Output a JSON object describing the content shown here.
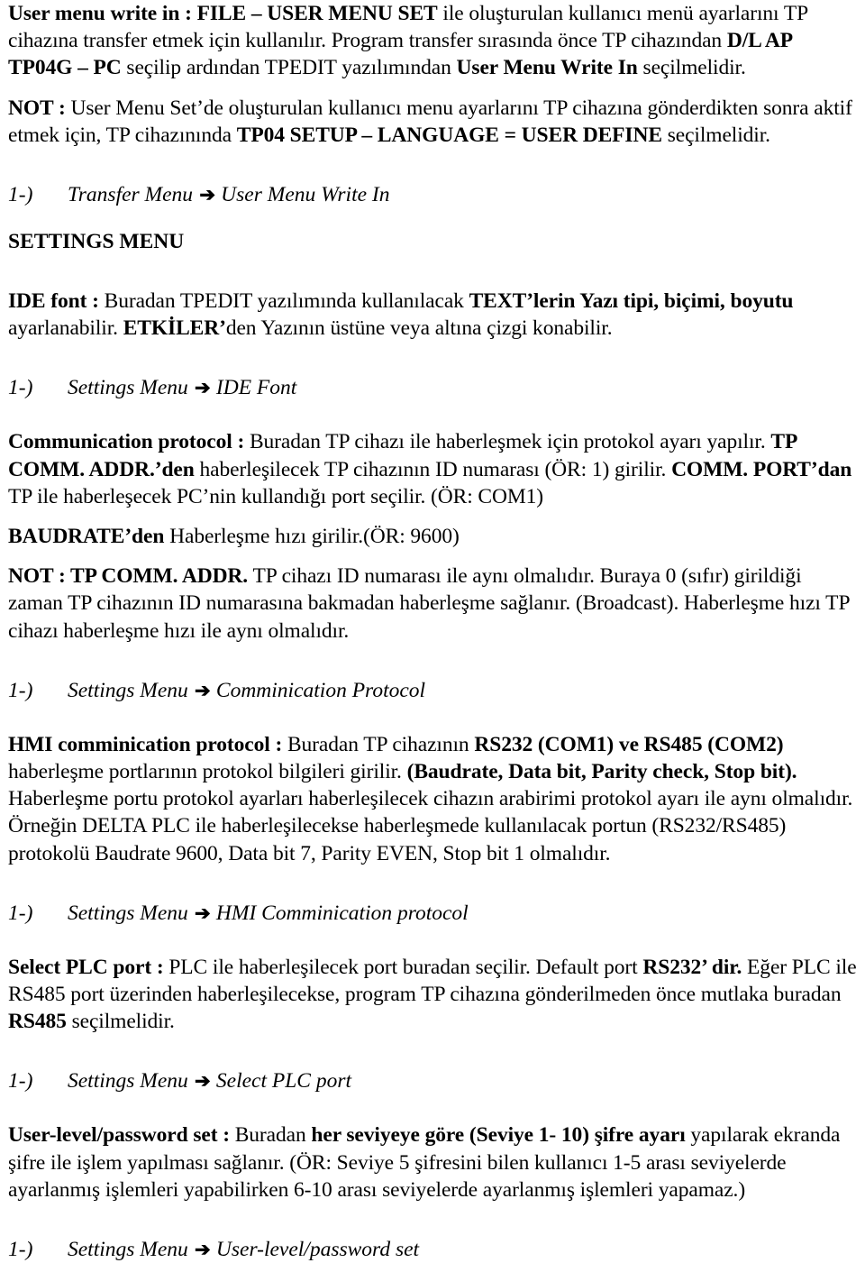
{
  "document": {
    "language": "tr",
    "arrow_glyph": "➔"
  },
  "sections": [
    {
      "id": "user-menu-write-in",
      "type": "paragraph",
      "runs": [
        {
          "text": "User menu write in : FILE ",
          "bold": true
        },
        {
          "text": "–",
          "bold": true
        },
        {
          "text": " USER MENU SET",
          "bold": true
        },
        {
          "text": " ile oluşturulan kullanıcı menü ayarlarını TP cihazına transfer etmek için kullanılır. Program transfer sırasında önce TP cihazından ",
          "bold": false
        },
        {
          "text": "D/L AP TP04G – PC",
          "bold": true
        },
        {
          "text": " seçilip ardından TPEDIT yazılımından ",
          "bold": false
        },
        {
          "text": "User Menu Write In",
          "bold": true
        },
        {
          "text": " seçilmelidir.",
          "bold": false
        }
      ]
    },
    {
      "id": "user-menu-note",
      "type": "paragraph",
      "runs": [
        {
          "text": "NOT :",
          "bold": true
        },
        {
          "text": " User Menu Set’de oluşturulan kullanıcı menu ayarlarını TP cihazına gönderdikten sonra aktif etmek için, TP cihazınında ",
          "bold": false
        },
        {
          "text": "TP04 SETUP – LANGUAGE = USER DEFINE",
          "bold": true
        },
        {
          "text": " seçilmelidir.",
          "bold": false
        }
      ]
    },
    {
      "id": "nav-transfer-menu",
      "type": "nav",
      "number": "1-)",
      "path_start": "Transfer Menu",
      "path_end": "User Menu Write In"
    },
    {
      "id": "settings-menu-heading",
      "type": "heading",
      "text": "SETTINGS MENU"
    },
    {
      "id": "ide-font",
      "type": "paragraph",
      "runs": [
        {
          "text": "IDE font :",
          "bold": true
        },
        {
          "text": " Buradan TPEDIT yazılımında kullanılacak ",
          "bold": false
        },
        {
          "text": "TEXT’lerin Yazı tipi, biçimi, boyutu",
          "bold": true
        },
        {
          "text": " ayarlanabilir. ",
          "bold": false
        },
        {
          "text": "ETKİLER’",
          "bold": true
        },
        {
          "text": "den Yazının üstüne veya altına çizgi konabilir.",
          "bold": false
        }
      ]
    },
    {
      "id": "nav-ide-font",
      "type": "nav",
      "number": "1-)",
      "path_start": "Settings Menu",
      "path_end": "IDE Font"
    },
    {
      "id": "communication-protocol",
      "type": "paragraph",
      "runs": [
        {
          "text": "Communication protocol :",
          "bold": true
        },
        {
          "text": " Buradan TP cihazı ile haberleşmek için protokol ayarı yapılır. ",
          "bold": false
        },
        {
          "text": "TP COMM. ADDR.’den",
          "bold": true
        },
        {
          "text": " haberleşilecek TP cihazının ID numarası (ÖR: 1) girilir. ",
          "bold": false
        },
        {
          "text": "COMM. PORT’dan",
          "bold": true
        },
        {
          "text": " TP ile haberleşecek PC’nin kullandığı port seçilir. (ÖR: COM1)",
          "bold": false
        }
      ]
    },
    {
      "id": "baudrate-line",
      "type": "paragraph",
      "runs": [
        {
          "text": "BAUDRATE’den",
          "bold": true
        },
        {
          "text": " Haberleşme hızı girilir.(ÖR: 9600)",
          "bold": false
        }
      ]
    },
    {
      "id": "comm-note",
      "type": "paragraph",
      "runs": [
        {
          "text": "NOT : TP COMM. ADDR.",
          "bold": true
        },
        {
          "text": " TP cihazı ID numarası ile aynı olmalıdır. Buraya 0 (sıfır) girildiği zaman TP cihazının ID numarasına bakmadan haberleşme sağlanır. (Broadcast). Haberleşme hızı TP cihazı haberleşme hızı ile aynı olmalıdır.",
          "bold": false
        }
      ]
    },
    {
      "id": "nav-comm-protocol",
      "type": "nav",
      "number": "1-)",
      "path_start": "Settings Menu",
      "path_end": "Comminication Protocol"
    },
    {
      "id": "hmi-comm-protocol",
      "type": "paragraph",
      "runs": [
        {
          "text": "HMI comminication protocol :",
          "bold": true
        },
        {
          "text": " Buradan TP cihazının ",
          "bold": false
        },
        {
          "text": "RS232 (COM1) ve RS485 (COM2)",
          "bold": true
        },
        {
          "text": " haberleşme portlarının protokol bilgileri girilir. ",
          "bold": false
        },
        {
          "text": "(Baudrate, Data bit, Parity check, Stop bit).",
          "bold": true
        },
        {
          "text": " Haberleşme portu protokol ayarları haberleşilecek cihazın arabirimi protokol ayarı ile aynı olmalıdır. Örneğin DELTA PLC ile haberleşilecekse haberleşmede kullanılacak portun (RS232/RS485) protokolü Baudrate 9600, Data bit 7, Parity EVEN, Stop bit 1 olmalıdır.",
          "bold": false
        }
      ]
    },
    {
      "id": "nav-hmi-comm",
      "type": "nav",
      "number": "1-)",
      "path_start": "Settings Menu",
      "path_end": "HMI Comminication protocol"
    },
    {
      "id": "select-plc-port",
      "type": "paragraph",
      "runs": [
        {
          "text": "Select PLC port :",
          "bold": true
        },
        {
          "text": " PLC ile haberleşilecek port buradan seçilir. Default port ",
          "bold": false
        },
        {
          "text": "RS232’ dir.",
          "bold": true
        },
        {
          "text": " Eğer PLC ile RS485 port üzerinden haberleşilecekse, program TP cihazına gönderilmeden önce mutlaka buradan ",
          "bold": false
        },
        {
          "text": "RS485",
          "bold": true
        },
        {
          "text": " seçilmelidir.",
          "bold": false
        }
      ]
    },
    {
      "id": "nav-select-plc-port",
      "type": "nav",
      "number": "1-)",
      "path_start": "Settings Menu",
      "path_end": "Select PLC port"
    },
    {
      "id": "user-level-password-set",
      "type": "paragraph",
      "runs": [
        {
          "text": "User-level/password set :",
          "bold": true
        },
        {
          "text": " Buradan ",
          "bold": false
        },
        {
          "text": "her seviyeye göre (Seviye 1- 10) şifre ayarı",
          "bold": true
        },
        {
          "text": " yapılarak ekranda şifre ile işlem yapılması sağlanır. (ÖR: Seviye 5 şifresini bilen kullanıcı 1-5 arası seviyelerde ayarlanmış işlemleri yapabilirken 6-10 arası seviyelerde ayarlanmış işlemleri yapamaz.)",
          "bold": false
        }
      ]
    },
    {
      "id": "nav-user-level-password",
      "type": "nav",
      "number": "1-)",
      "path_start": "Settings Menu",
      "path_end": "User-level/password set"
    }
  ]
}
